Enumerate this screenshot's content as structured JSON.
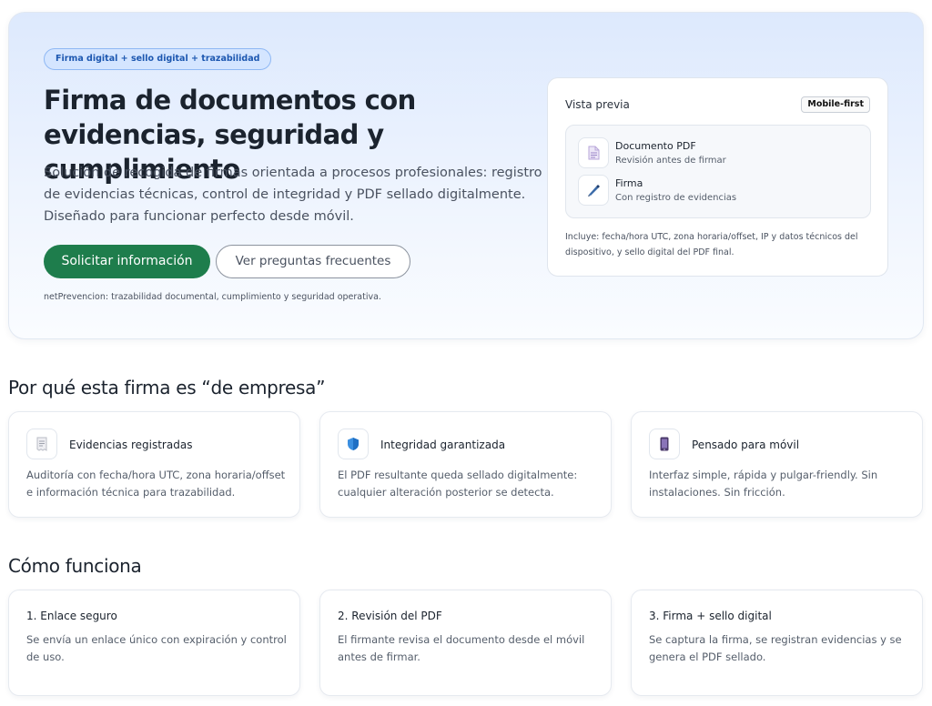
{
  "hero": {
    "pill": "Firma digital + sello digital + trazabilidad",
    "title": "Firma de documentos con evidencias, seguridad y cumplimiento",
    "description": "Solución de recogida de firmas orientada a procesos profesionales: registro de evidencias técnicas, control de integridad y PDF sellado digitalmente. Diseñado para funcionar perfecto desde móvil.",
    "primary_button": "Solicitar información",
    "secondary_button": "Ver preguntas frecuentes",
    "footnote": "netPrevencion: trazabilidad documental, cumplimiento y seguridad operativa."
  },
  "preview": {
    "title": "Vista previa",
    "badge": "Mobile-first",
    "items": [
      {
        "icon": "document-icon",
        "title": "Documento PDF",
        "subtitle": "Revisión antes de firmar"
      },
      {
        "icon": "pen-icon",
        "title": "Firma",
        "subtitle": "Con registro de evidencias"
      }
    ],
    "note": "Incluye: fecha/hora UTC, zona horaria/offset, IP y datos técnicos del dispositivo, y sello digital del PDF final."
  },
  "why": {
    "title": "Por qué esta firma es “de empresa”",
    "cards": [
      {
        "icon": "receipt-icon",
        "title": "Evidencias registradas",
        "description": "Auditoría con fecha/hora UTC, zona horaria/offset e información técnica para trazabilidad."
      },
      {
        "icon": "shield-icon",
        "title": "Integridad garantizada",
        "description": "El PDF resultante queda sellado digitalmente: cualquier alteración posterior se detecta."
      },
      {
        "icon": "mobile-phone-icon",
        "title": "Pensado para móvil",
        "description": "Interfaz simple, rápida y pulgar-friendly. Sin instalaciones. Sin fricción."
      }
    ]
  },
  "how": {
    "title": "Cómo funciona",
    "steps": [
      {
        "title": "1.  Enlace seguro",
        "description": "Se envía un enlace único con expiración y control de uso."
      },
      {
        "title": "2.  Revisión del PDF",
        "description": "El firmante revisa el documento desde el móvil antes de firmar."
      },
      {
        "title": "3.  Firma + sello digital",
        "description": "Se captura la firma, se registran evidencias y se genera el PDF sellado."
      }
    ]
  },
  "colors": {
    "primary_green": "#1e7d4c",
    "pill_blue": "#1c57b0",
    "hero_gradient_top": "#dde9fd"
  }
}
